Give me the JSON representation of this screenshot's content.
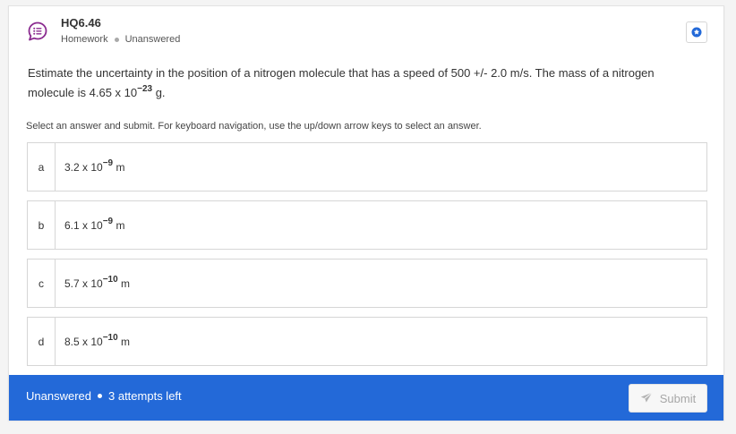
{
  "header": {
    "code": "HQ6.46",
    "category": "Homework",
    "status": "Unanswered"
  },
  "question": {
    "text_before": "Estimate the uncertainty in the position of a nitrogen molecule that has a speed of 500 +/- 2.0 m/s. The mass of a nitrogen molecule is 4.65 x 10",
    "exponent": "−23",
    "text_after": " g."
  },
  "instructions": "Select an answer and submit. For keyboard navigation, use the up/down arrow keys to select an answer.",
  "options": [
    {
      "letter": "a",
      "mantissa": "3.2 x 10",
      "exponent": "−9",
      "unit": " m"
    },
    {
      "letter": "b",
      "mantissa": "6.1 x 10",
      "exponent": "−9",
      "unit": " m"
    },
    {
      "letter": "c",
      "mantissa": "5.7 x 10",
      "exponent": "−10",
      "unit": " m"
    },
    {
      "letter": "d",
      "mantissa": "8.5 x 10",
      "exponent": "−10",
      "unit": " m"
    }
  ],
  "footer": {
    "status": "Unanswered",
    "attempts": "3 attempts left",
    "submit_label": "Submit"
  },
  "colors": {
    "accent": "#2369d8",
    "icon_purple": "#8a2a8f"
  },
  "icons": {
    "question_type": "chat-bubble-list-icon",
    "bookmark": "star-badge-icon",
    "submit": "paper-plane-icon"
  }
}
